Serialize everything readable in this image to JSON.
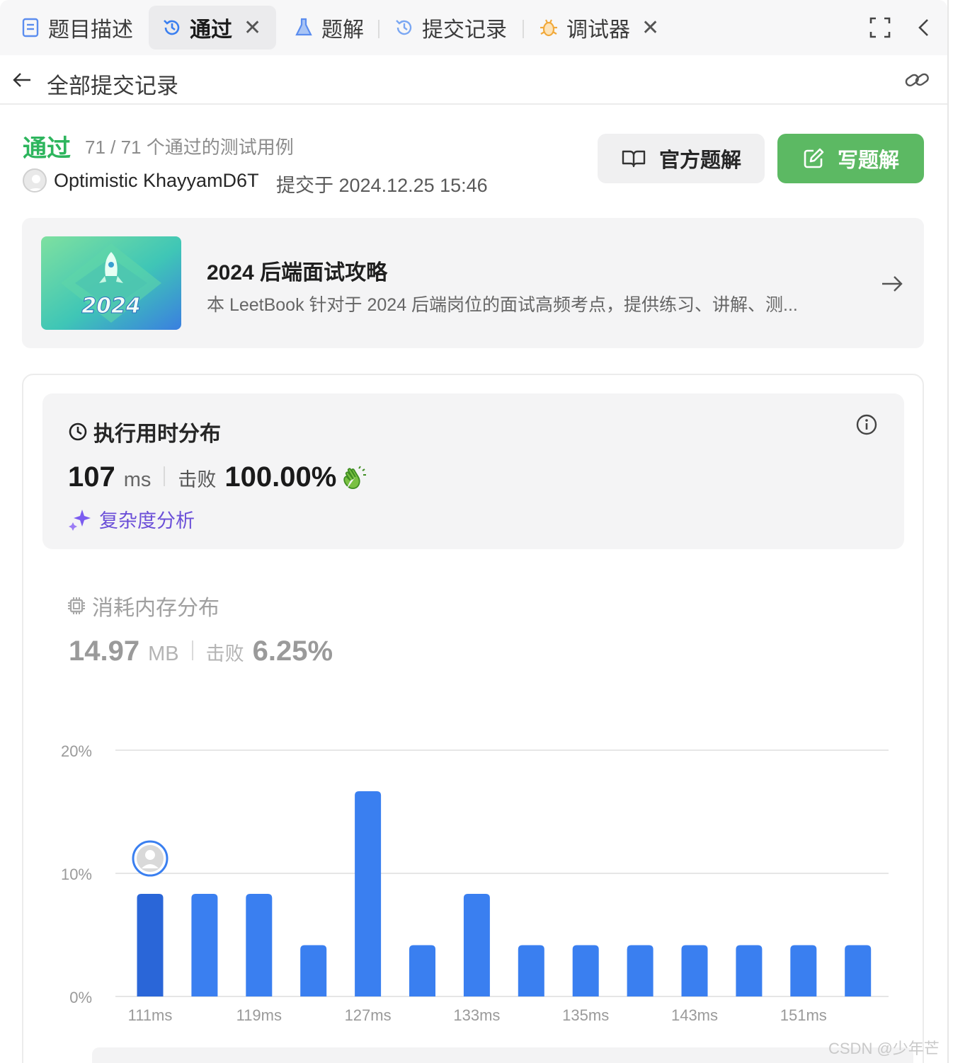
{
  "tabs": [
    {
      "label": "题目描述",
      "icon": "document-icon"
    },
    {
      "label": "通过",
      "icon": "history-icon",
      "closable": true,
      "active": true
    },
    {
      "label": "题解",
      "icon": "flask-icon"
    },
    {
      "label": "提交记录",
      "icon": "history-icon"
    },
    {
      "label": "调试器",
      "icon": "bug-icon",
      "closable": true
    }
  ],
  "close_glyph": "✕",
  "subheader": {
    "title": "全部提交记录"
  },
  "submission": {
    "status": "通过",
    "cases": "71 / 71 个通过的测试用例",
    "user": "Optimistic KhayyamD6T",
    "submitted": "提交于 2024.12.25 15:46"
  },
  "buttons": {
    "official": "官方题解",
    "write": "写题解"
  },
  "banner": {
    "image_text": "2024",
    "title": "2024 后端面试攻略",
    "desc": "本 LeetBook 针对于 2024 后端岗位的面试高频考点，提供练习、讲解、测..."
  },
  "runtime": {
    "title": "执行用时分布",
    "value": "107",
    "unit": "ms",
    "beat_label": "击败",
    "beat_value": "100.00%",
    "complexity": "复杂度分析"
  },
  "memory": {
    "title": "消耗内存分布",
    "value": "14.97",
    "unit": "MB",
    "beat_label": "击败",
    "beat_value": "6.25%"
  },
  "colors": {
    "accent_green": "#2db55d",
    "bar_blue": "#3a7ff0",
    "bar_highlight": "#2a66d8",
    "purple": "#6b4fd8"
  },
  "chart_data": {
    "type": "bar",
    "y_ticks": [
      "20%",
      "10%",
      "0%"
    ],
    "ylim": [
      0,
      20
    ],
    "x_tick_labels": [
      "111ms",
      "119ms",
      "127ms",
      "133ms",
      "135ms",
      "143ms",
      "151ms"
    ],
    "values": [
      8.33,
      8.33,
      8.33,
      4.17,
      16.67,
      4.17,
      8.33,
      4.17,
      4.17,
      4.17,
      4.17,
      4.17,
      4.17,
      4.17
    ],
    "highlight_index": 0
  },
  "watermark": "CSDN @少年芒"
}
